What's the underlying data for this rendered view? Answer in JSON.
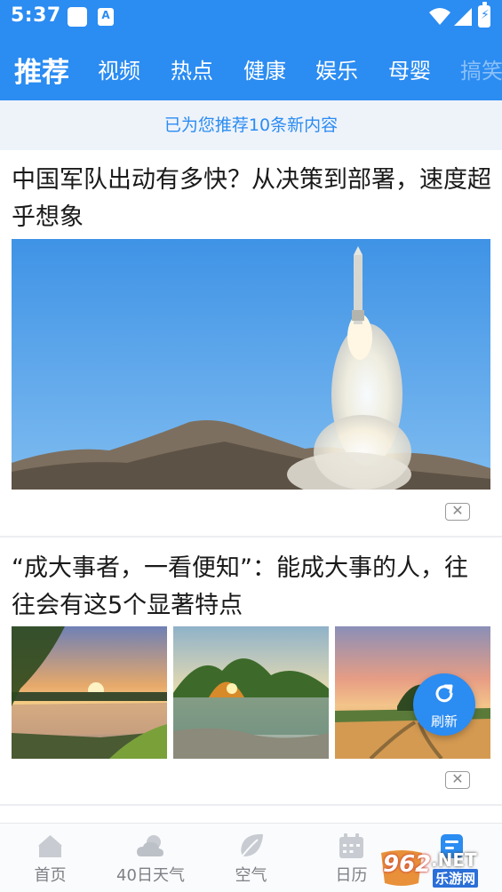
{
  "status_bar": {
    "time": "5:37",
    "app_badge_letter": "A"
  },
  "tabs": [
    {
      "label": "推荐",
      "active": true
    },
    {
      "label": "视频"
    },
    {
      "label": "热点"
    },
    {
      "label": "健康"
    },
    {
      "label": "娱乐"
    },
    {
      "label": "母婴"
    },
    {
      "label": "搞笑"
    }
  ],
  "banner": {
    "text": "已为您推荐10条新内容"
  },
  "articles": [
    {
      "title": "中国军队出动有多快？从决策到部署，速度超乎想象",
      "image": "missile-launch-photo",
      "close_symbol": "✕"
    },
    {
      "title": "“成大事者，一看便知”：能成大事的人，往往会有这5个显著特点",
      "images": [
        "sunset-river-photo",
        "lake-autumn-trees-photo",
        "field-sunset-photo"
      ],
      "close_symbol": "✕"
    }
  ],
  "refresh_button": {
    "label": "刷新",
    "icon": "refresh-icon"
  },
  "bottom_nav": [
    {
      "label": "首页",
      "icon": "home-icon"
    },
    {
      "label": "40日天气",
      "icon": "cloud-icon"
    },
    {
      "label": "空气",
      "icon": "leaf-icon"
    },
    {
      "label": "日历",
      "icon": "calendar-icon"
    },
    {
      "label": "",
      "icon": "news-icon",
      "active": true
    }
  ],
  "watermark": {
    "number": "962",
    "suffix": ".NET",
    "cn": "乐游网"
  },
  "colors": {
    "brand": "#2b8cf2",
    "banner_bg": "#eef3fa",
    "text": "#1a1a1a",
    "muted": "#7d8085"
  }
}
